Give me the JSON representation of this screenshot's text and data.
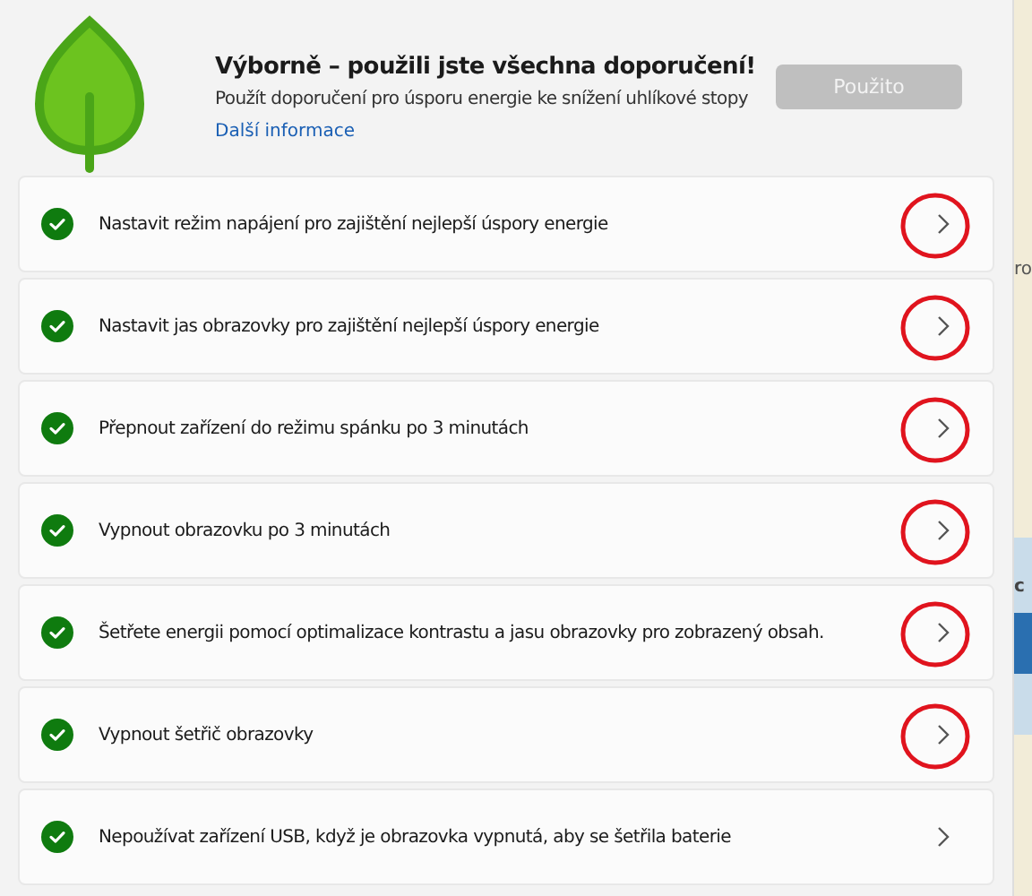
{
  "header": {
    "title": "Výborně – použili jste všechna doporučení!",
    "description": "Použít doporučení pro úsporu energie ke snížení uhlíkové stopy",
    "link": "Další informace",
    "button": {
      "label": "Použito",
      "disabled": true
    }
  },
  "recommendations": [
    {
      "label": "Nastavit režim napájení pro zajištění nejlepší úspory energie",
      "done": true,
      "circled": true
    },
    {
      "label": "Nastavit jas obrazovky pro zajištění nejlepší úspory energie",
      "done": true,
      "circled": true
    },
    {
      "label": "Přepnout zařízení do režimu spánku po 3 minutách",
      "done": true,
      "circled": true
    },
    {
      "label": "Vypnout obrazovku po 3 minutách",
      "done": true,
      "circled": true
    },
    {
      "label": "Šetřete energii pomocí optimalizace kontrastu a jasu obrazovky pro zobrazený obsah.",
      "done": true,
      "circled": true
    },
    {
      "label": "Vypnout šetřič obrazovky",
      "done": true,
      "circled": true
    },
    {
      "label": "Nepoužívat zařízení USB, když je obrazovka vypnutá, aby se šetřila baterie",
      "done": true,
      "circled": false
    }
  ],
  "background_window": {
    "texts": [
      "ro",
      "c"
    ]
  }
}
